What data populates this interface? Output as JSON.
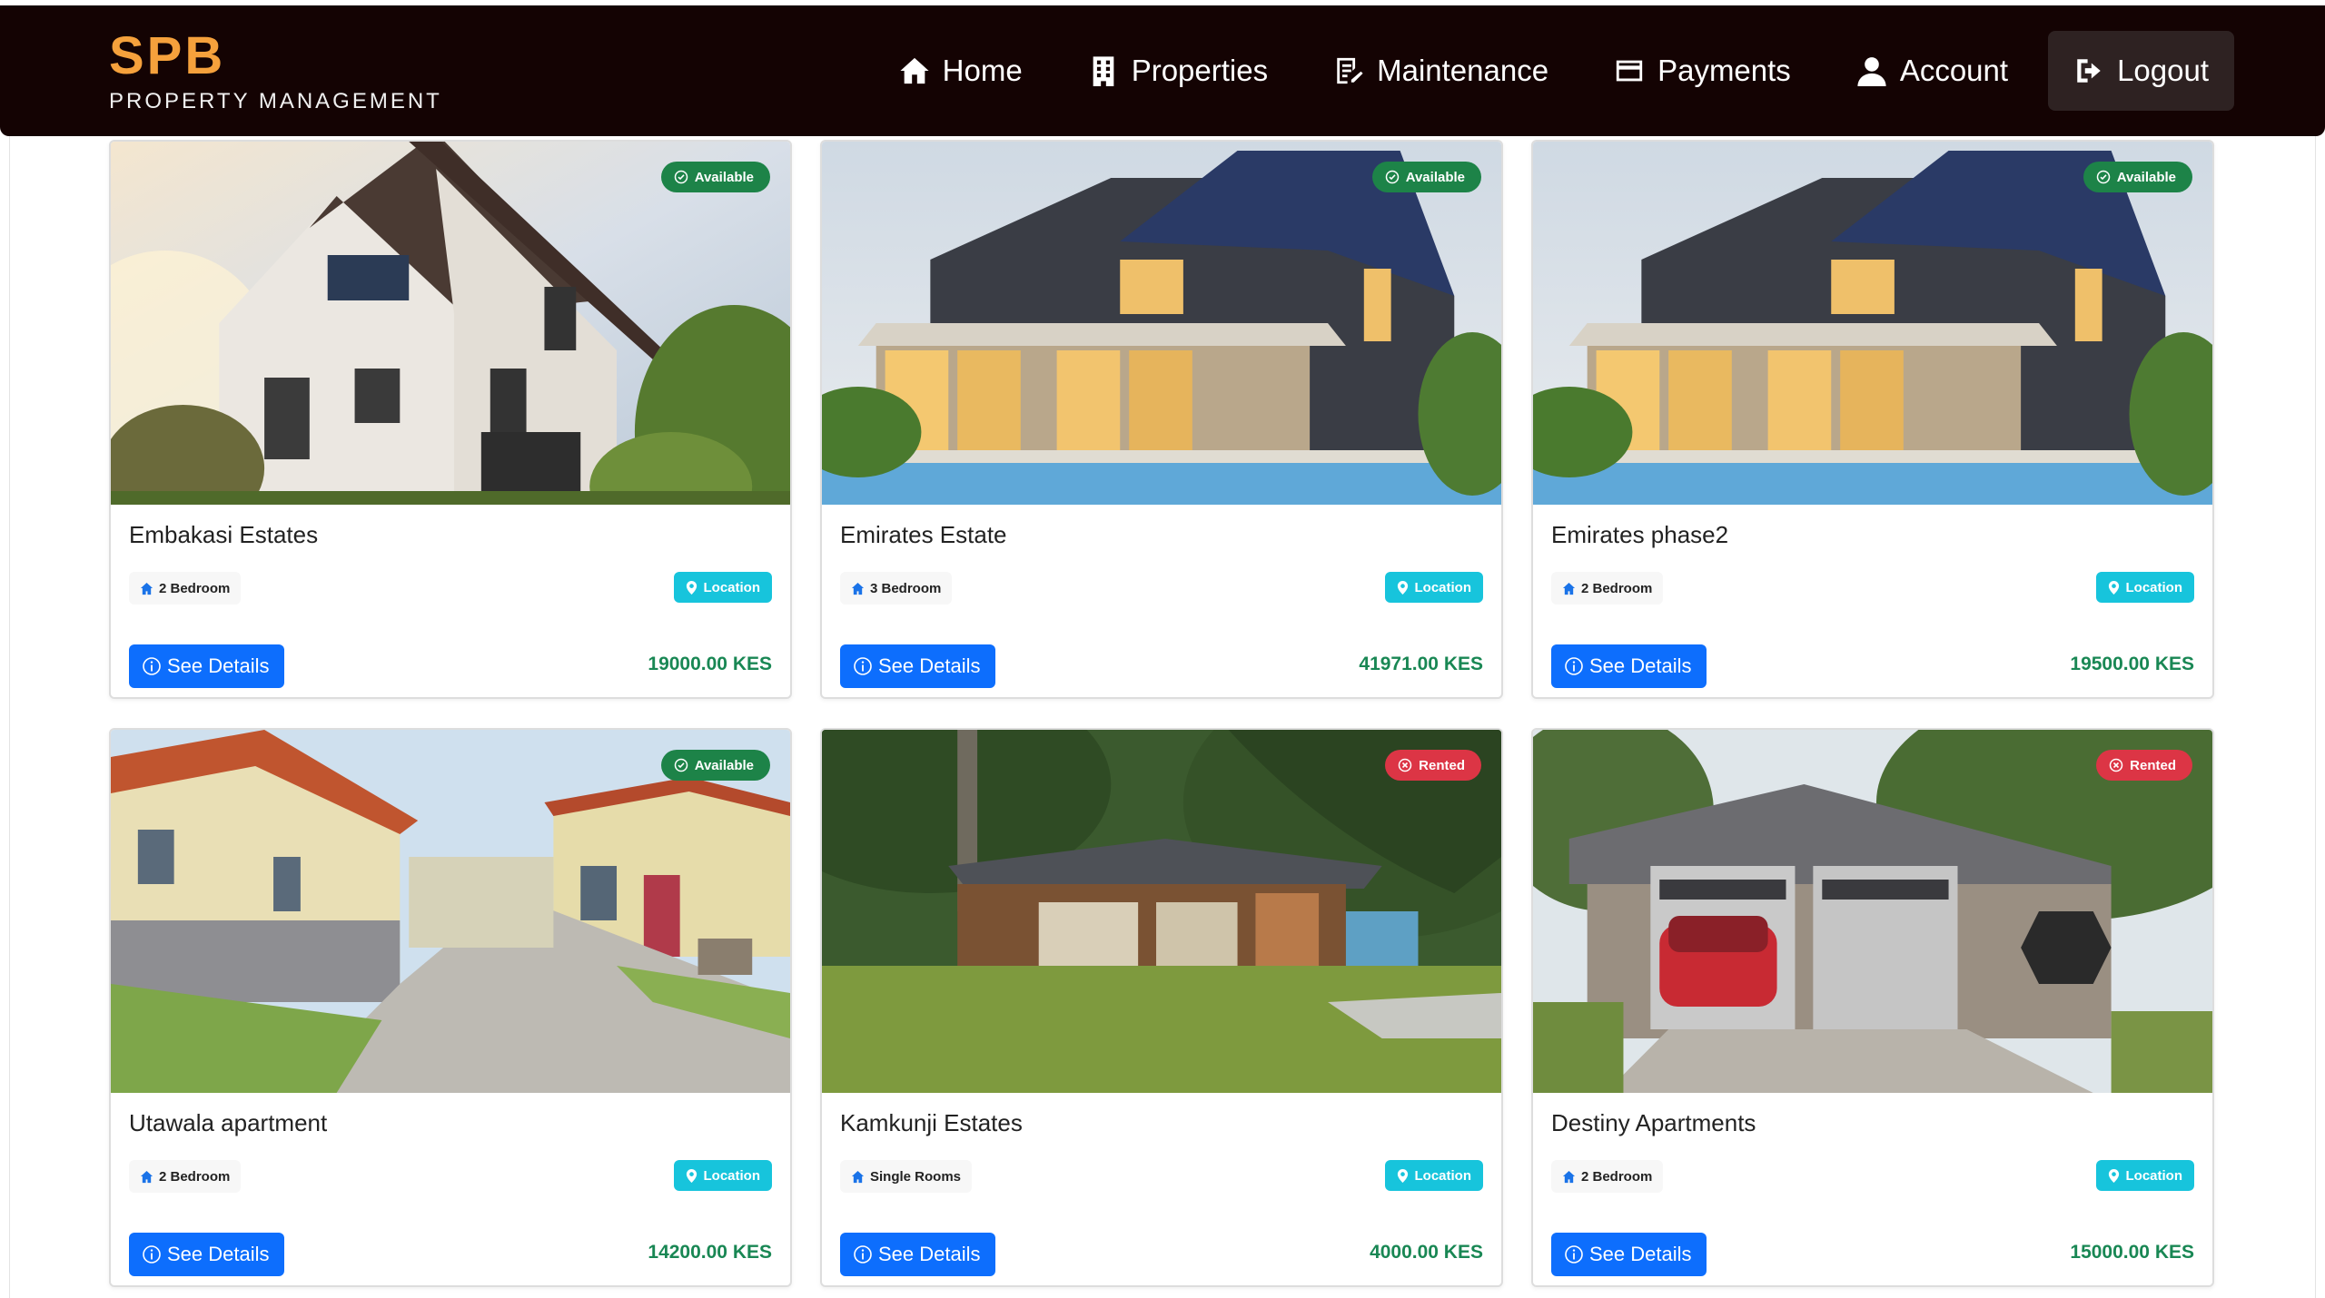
{
  "brand": {
    "name": "SPB",
    "subtitle": "PROPERTY MANAGEMENT"
  },
  "nav": [
    {
      "label": "Home",
      "icon": "home-icon"
    },
    {
      "label": "Properties",
      "icon": "building-icon"
    },
    {
      "label": "Maintenance",
      "icon": "clipboard-icon"
    },
    {
      "label": "Payments",
      "icon": "credit-card-icon"
    },
    {
      "label": "Account",
      "icon": "user-icon"
    },
    {
      "label": "Logout",
      "icon": "logout-icon"
    }
  ],
  "card_ui": {
    "location_label": "Location",
    "details_label": "See Details"
  },
  "properties": [
    {
      "name": "Embakasi Estates",
      "bedroom": "2 Bedroom",
      "status": "Available",
      "price": "19000.00 KES"
    },
    {
      "name": "Emirates Estate",
      "bedroom": "3 Bedroom",
      "status": "Available",
      "price": "41971.00 KES"
    },
    {
      "name": "Emirates phase2",
      "bedroom": "2 Bedroom",
      "status": "Available",
      "price": "19500.00 KES"
    },
    {
      "name": "Utawala apartment",
      "bedroom": "2 Bedroom",
      "status": "Available",
      "price": "14200.00 KES"
    },
    {
      "name": "Kamkunji Estates",
      "bedroom": "Single Rooms",
      "status": "Rented",
      "price": "4000.00 KES"
    },
    {
      "name": "Destiny Apartments",
      "bedroom": "2 Bedroom",
      "status": "Rented",
      "price": "15000.00 KES"
    }
  ],
  "colors": {
    "navbar": "#140303",
    "brand": "#f5a13c",
    "available": "#1d8348",
    "rented": "#dc3545",
    "location": "#17c4dc",
    "button": "#0d6efd",
    "price": "#198754"
  }
}
